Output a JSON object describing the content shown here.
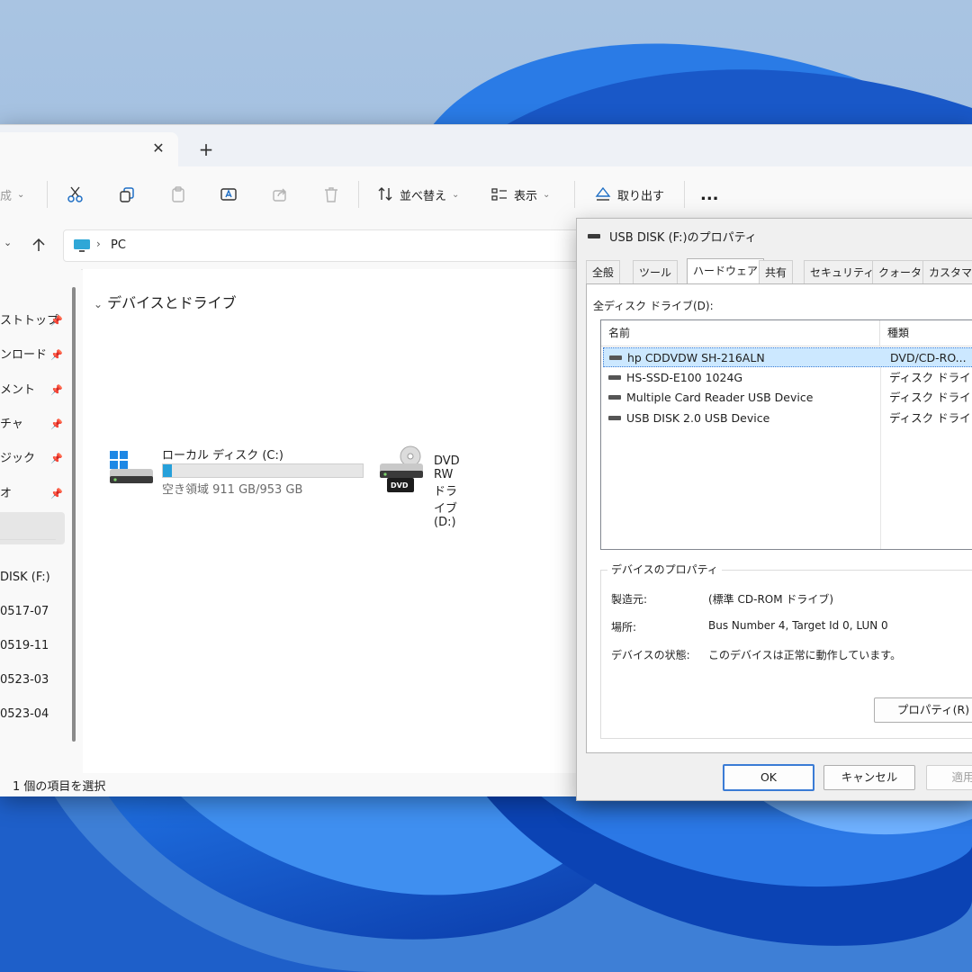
{
  "explorer": {
    "toolbar": {
      "new_label": "成",
      "sort_label": "並べ替え",
      "view_label": "表示",
      "eject_label": "取り出す",
      "more_label": "..."
    },
    "address": {
      "location": "PC"
    },
    "sidebar": {
      "items": [
        {
          "label": "ストトップ",
          "pinned": true
        },
        {
          "label": "ンロード",
          "pinned": true
        },
        {
          "label": "メント",
          "pinned": true
        },
        {
          "label": "チャ",
          "pinned": true
        },
        {
          "label": "ジック",
          "pinned": true
        },
        {
          "label": "オ",
          "pinned": true
        },
        {
          "label": ""
        },
        {
          "label": "DISK (F:)"
        },
        {
          "label": "0517-07"
        },
        {
          "label": "0519-11"
        },
        {
          "label": "0523-03"
        },
        {
          "label": "0523-04"
        }
      ]
    },
    "content": {
      "group_title": "デバイスとドライブ",
      "drives": [
        {
          "name": "ローカル ディスク (C:)",
          "free_text": "空き領域 911 GB/953 GB",
          "used_fraction": 0.044
        },
        {
          "name": "DVD RW ドライブ (D:)",
          "badge": "DVD"
        }
      ]
    },
    "status": "1 個の項目を選択"
  },
  "dialog": {
    "title": "USB DISK (F:)のプロパティ",
    "tabs": [
      "全般",
      "ツール",
      "ハードウェア",
      "共有",
      "セキュリティ",
      "クォータ",
      "カスタマイ"
    ],
    "active_tab": "ハードウェア",
    "list_label": "全ディスク ドライブ(D):",
    "columns": [
      "名前",
      "種類"
    ],
    "devices": [
      {
        "name": "hp CDDVDW SH-216ALN",
        "type": "DVD/CD-RO...",
        "selected": true
      },
      {
        "name": "HS-SSD-E100 1024G",
        "type": "ディスク ドライブ"
      },
      {
        "name": "Multiple Card  Reader USB Device",
        "type": "ディスク ドライブ"
      },
      {
        "name": "USB DISK 2.0 USB Device",
        "type": "ディスク ドライブ"
      }
    ],
    "props_group_title": "デバイスのプロパティ",
    "props": {
      "manufacturer_label": "製造元:",
      "manufacturer": "(標準 CD-ROM ドライブ)",
      "location_label": "場所:",
      "location": "Bus Number 4, Target Id 0, LUN 0",
      "status_label": "デバイスの状態:",
      "status": "このデバイスは正常に動作しています。"
    },
    "properties_button": "プロパティ(R)",
    "ok_button": "OK",
    "cancel_button": "キャンセル",
    "apply_button": "適用"
  },
  "colors": {
    "accent": "#26a0da",
    "selection": "#cce8ff",
    "wallpaper": "#5f8fce"
  }
}
